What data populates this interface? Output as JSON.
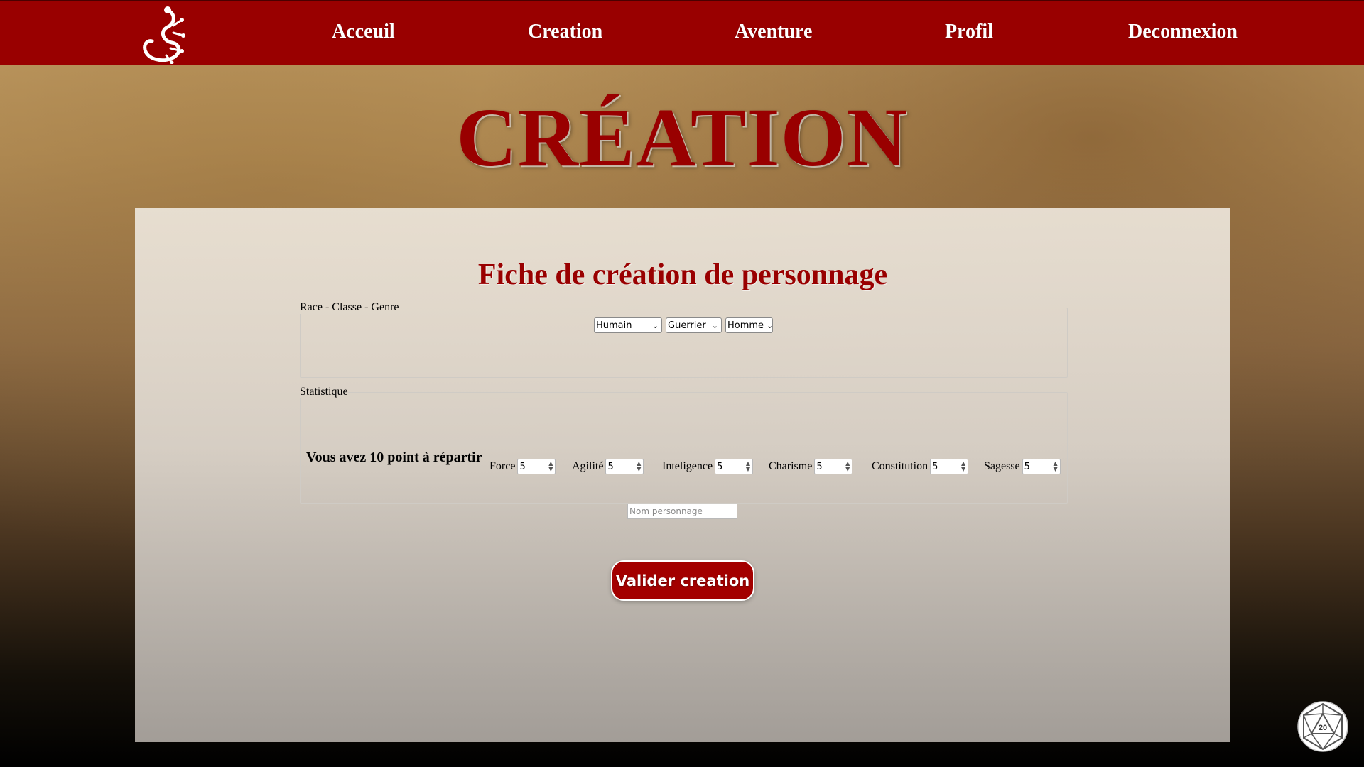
{
  "nav": {
    "links": [
      "Acceuil",
      "Creation",
      "Aventure",
      "Profil",
      "Deconnexion"
    ]
  },
  "page": {
    "title": "CRÉATION"
  },
  "form": {
    "title": "Fiche de création de personnage",
    "race_legend": "Race - Classe - Genre",
    "race": "Humain",
    "classe": "Guerrier",
    "genre": "Homme",
    "stats_legend": "Statistique",
    "points_text": "Vous avez 10 point à répartir",
    "stats": [
      {
        "label": "Force",
        "value": "5"
      },
      {
        "label": "Agilité",
        "value": "5"
      },
      {
        "label": "Inteligence",
        "value": "5"
      },
      {
        "label": "Charisme",
        "value": "5"
      },
      {
        "label": "Constitution",
        "value": "5"
      },
      {
        "label": "Sagesse",
        "value": "5"
      }
    ],
    "name_placeholder": "Nom personnage",
    "submit_label": "Valider creation"
  },
  "colors": {
    "brand": "#990000",
    "text": "#000000",
    "button_text": "#ffffff"
  },
  "icons": {
    "logo": "gecko-logo-icon",
    "corner": "d20-dice-icon"
  }
}
